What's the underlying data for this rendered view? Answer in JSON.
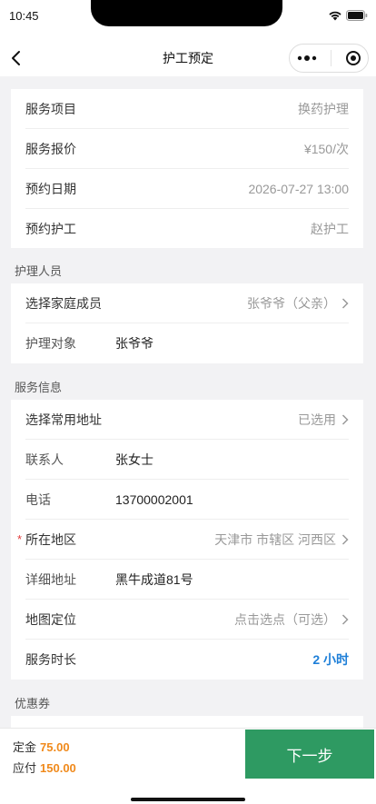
{
  "status_bar": {
    "time": "10:45"
  },
  "nav": {
    "title": "护工预定"
  },
  "service_card": {
    "rows": [
      {
        "label": "服务项目",
        "value": "换药护理"
      },
      {
        "label": "服务报价",
        "value": "¥150/次"
      },
      {
        "label": "预约日期",
        "value": "2026-07-27 13:00"
      },
      {
        "label": "预约护工",
        "value": "赵护工"
      }
    ]
  },
  "caregiver_section": {
    "title": "护理人员",
    "select_member": {
      "label": "选择家庭成员",
      "value": "张爷爷（父亲）"
    },
    "target": {
      "label": "护理对象",
      "value": "张爷爷"
    }
  },
  "service_info_section": {
    "title": "服务信息",
    "address_select": {
      "label": "选择常用地址",
      "value": "已选用"
    },
    "contact": {
      "label": "联系人",
      "value": "张女士"
    },
    "phone": {
      "label": "电话",
      "value": "13700002001"
    },
    "region": {
      "label": "所在地区",
      "value": "天津市 市辖区 河西区",
      "required_mark": "*"
    },
    "detail_address": {
      "label": "详细地址",
      "value": "黑牛成道81号"
    },
    "map_location": {
      "label": "地图定位",
      "value": "点击选点（可选）"
    },
    "duration": {
      "label": "服务时长",
      "value": "2 小时"
    }
  },
  "coupon_section": {
    "title": "优惠券"
  },
  "bottom_bar": {
    "deposit_label": "定金",
    "deposit_amount": "75.00",
    "payable_label": "应付",
    "payable_amount": "150.00",
    "next_label": "下一步"
  },
  "colors": {
    "accent_blue": "#1e7fd8",
    "price_orange": "#f08a1c",
    "primary_green": "#2e9a62",
    "required_red": "#e23b3b"
  }
}
